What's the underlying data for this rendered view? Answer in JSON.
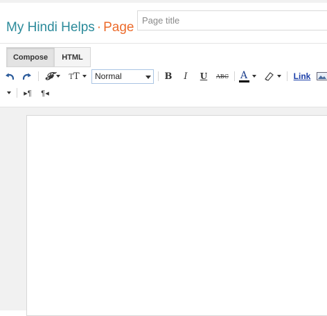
{
  "header": {
    "blog_name": "My Hindi Helps",
    "separator": "·",
    "item_type": "Page",
    "title_input": {
      "value": "",
      "placeholder": "Page title"
    }
  },
  "mode_tabs": [
    {
      "label": "Compose",
      "active": true
    },
    {
      "label": "HTML",
      "active": false
    }
  ],
  "toolbar": {
    "undo": "undo-icon",
    "redo": "redo-icon",
    "font": "font-family-icon",
    "font_size": "font-size-icon",
    "format_value": "Normal",
    "bold": "B",
    "italic": "I",
    "underline": "U",
    "strikethrough": "ABC",
    "text_color": "A",
    "link_label": "Link",
    "ltr": "left-to-right-icon",
    "rtl": "right-to-left-icon"
  },
  "colors": {
    "blog_name": "#2b8a9a",
    "item_type": "#ec6b2b",
    "link": "#1a3ea8",
    "workspace_bg": "#f1f1f1"
  },
  "editor": {
    "content": ""
  }
}
